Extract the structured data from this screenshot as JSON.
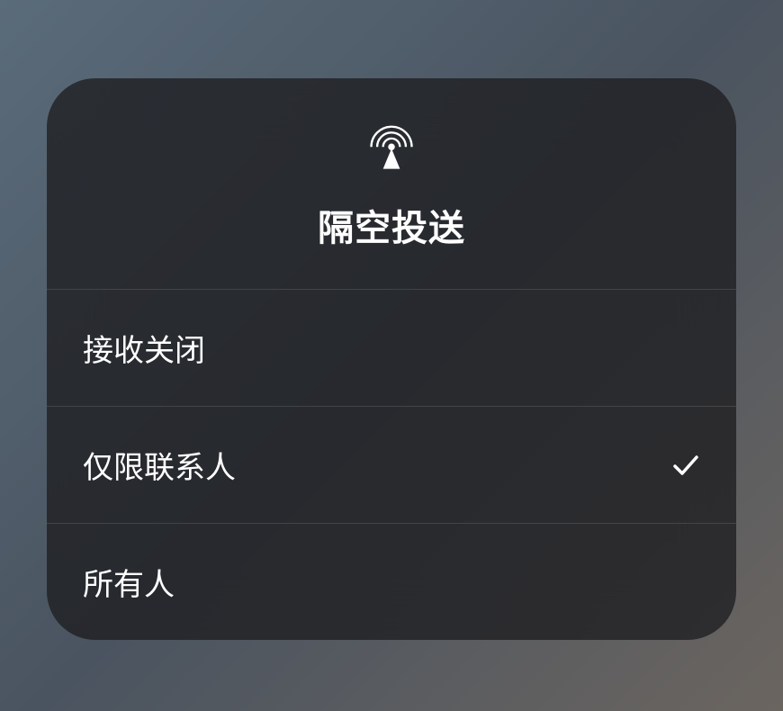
{
  "header": {
    "title": "隔空投送",
    "icon": "airdrop"
  },
  "options": [
    {
      "label": "接收关闭",
      "selected": false
    },
    {
      "label": "仅限联系人",
      "selected": true
    },
    {
      "label": "所有人",
      "selected": false
    }
  ]
}
